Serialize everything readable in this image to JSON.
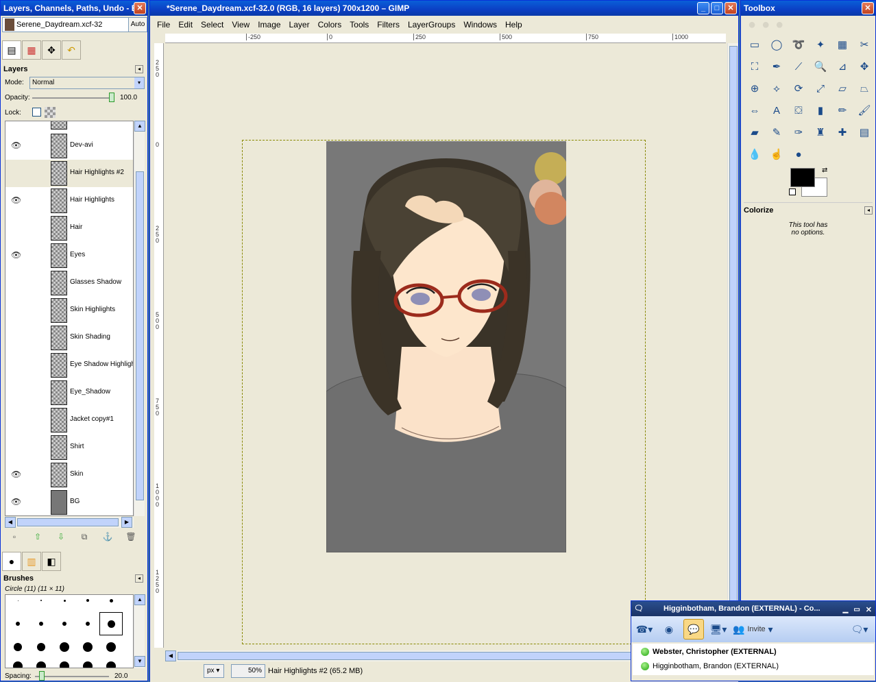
{
  "left_dock": {
    "title": "Layers, Channels, Paths, Undo - B...",
    "image_select": "Serene_Daydream.xcf-32",
    "auto_label": "Auto",
    "layers_panel": {
      "title": "Layers",
      "mode_label": "Mode:",
      "mode_value": "Normal",
      "opacity_label": "Opacity:",
      "opacity_value": "100.0",
      "lock_label": "Lock:",
      "layers": [
        {
          "name": "Dev-avi",
          "visible": true
        },
        {
          "name": "Hair Highlights #2",
          "visible": false,
          "selected": true
        },
        {
          "name": "Hair Highlights",
          "visible": true
        },
        {
          "name": "Hair",
          "visible": false
        },
        {
          "name": "Eyes",
          "visible": true
        },
        {
          "name": "Glasses Shadow",
          "visible": false
        },
        {
          "name": "Skin Highlights",
          "visible": false
        },
        {
          "name": "Skin Shading",
          "visible": false
        },
        {
          "name": "Eye Shadow Highlight",
          "visible": false
        },
        {
          "name": "Eye_Shadow",
          "visible": false
        },
        {
          "name": "Jacket copy#1",
          "visible": false
        },
        {
          "name": "Shirt",
          "visible": false
        },
        {
          "name": "Skin",
          "visible": true
        },
        {
          "name": "BG",
          "visible": true
        }
      ]
    },
    "brushes_panel": {
      "title": "Brushes",
      "selected_brush": "Circle (11) (11 × 11)",
      "spacing_label": "Spacing:",
      "spacing_value": "20.0"
    }
  },
  "image_window": {
    "title": "*Serene_Daydream.xcf-32.0 (RGB, 16 layers) 700x1200 – GIMP",
    "menu": [
      "File",
      "Edit",
      "Select",
      "View",
      "Image",
      "Layer",
      "Colors",
      "Tools",
      "Filters",
      "LayerGroups",
      "Windows",
      "Help"
    ],
    "ruler_h_ticks": [
      "-250",
      "0",
      "250",
      "500",
      "750",
      "1000"
    ],
    "ruler_v_ticks": [
      "2\n5\n0",
      "0",
      "2\n5\n0",
      "5\n0\n0",
      "7\n5\n0",
      "1\n0\n0\n0",
      "1\n2\n5\n0"
    ],
    "status": {
      "unit": "px",
      "zoom": "50%",
      "text": "Hair Highlights #2 (65.2 MB)"
    }
  },
  "toolbox": {
    "title": "Toolbox",
    "tools": [
      {
        "name": "rect-select-icon",
        "glyph": "▭"
      },
      {
        "name": "ellipse-select-icon",
        "glyph": "◯"
      },
      {
        "name": "free-select-icon",
        "glyph": "➰"
      },
      {
        "name": "fuzzy-select-icon",
        "glyph": "✦"
      },
      {
        "name": "color-select-icon",
        "glyph": "▦"
      },
      {
        "name": "scissors-icon",
        "glyph": "✂"
      },
      {
        "name": "foreground-select-icon",
        "glyph": "⛶"
      },
      {
        "name": "paths-icon",
        "glyph": "✒"
      },
      {
        "name": "color-picker-icon",
        "glyph": "⟋"
      },
      {
        "name": "zoom-icon",
        "glyph": "🔍"
      },
      {
        "name": "measure-icon",
        "glyph": "⊿"
      },
      {
        "name": "move-icon",
        "glyph": "✥"
      },
      {
        "name": "align-icon",
        "glyph": "⊕"
      },
      {
        "name": "crop-icon",
        "glyph": "⟡"
      },
      {
        "name": "rotate-icon",
        "glyph": "⟳"
      },
      {
        "name": "scale-icon",
        "glyph": "⤢"
      },
      {
        "name": "shear-icon",
        "glyph": "▱"
      },
      {
        "name": "perspective-icon",
        "glyph": "⏢"
      },
      {
        "name": "flip-icon",
        "glyph": "⇔"
      },
      {
        "name": "text-icon",
        "glyph": "A"
      },
      {
        "name": "bucket-fill-icon",
        "glyph": "⛋"
      },
      {
        "name": "blend-icon",
        "glyph": "▮"
      },
      {
        "name": "pencil-icon",
        "glyph": "✏"
      },
      {
        "name": "paintbrush-icon",
        "glyph": "🖌"
      },
      {
        "name": "eraser-icon",
        "glyph": "▰"
      },
      {
        "name": "airbrush-icon",
        "glyph": "✎"
      },
      {
        "name": "ink-icon",
        "glyph": "✑"
      },
      {
        "name": "clone-icon",
        "glyph": "♜"
      },
      {
        "name": "heal-icon",
        "glyph": "✚"
      },
      {
        "name": "perspective-clone-icon",
        "glyph": "▤"
      },
      {
        "name": "blur-icon",
        "glyph": "💧"
      },
      {
        "name": "smudge-icon",
        "glyph": "☝"
      },
      {
        "name": "dodge-burn-icon",
        "glyph": "●"
      }
    ],
    "tool_options": {
      "title": "Colorize",
      "no_options_line1": "This tool has",
      "no_options_line2": "no options."
    }
  },
  "chat_window": {
    "title": "Higginbotham, Brandon (EXTERNAL) - Co...",
    "invite_label": "Invite",
    "participants": [
      {
        "name": "Webster, Christopher (EXTERNAL)",
        "bold": true
      },
      {
        "name": "Higginbotham, Brandon (EXTERNAL)",
        "bold": false
      }
    ]
  }
}
